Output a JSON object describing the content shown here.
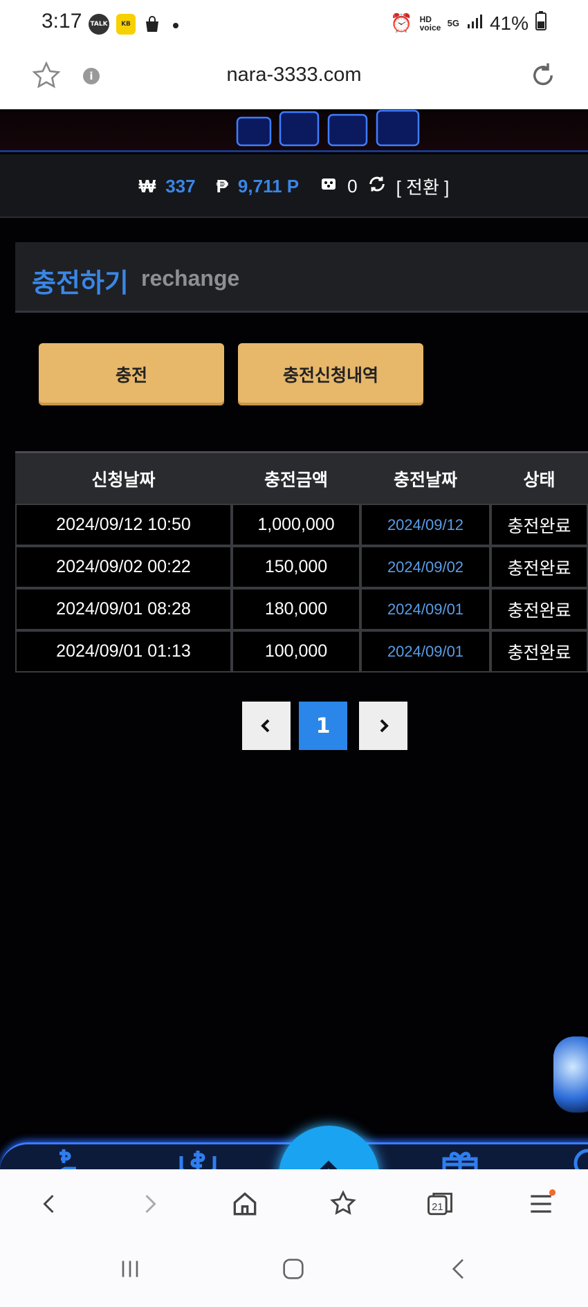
{
  "status_bar": {
    "time": "3:17",
    "battery": "41%",
    "signal_label": "5G",
    "hd_label": "HD voice"
  },
  "url_bar": {
    "url": "nara-3333.com"
  },
  "site": {
    "balance": {
      "won_symbol": "₩",
      "won_value": "337",
      "point_symbol": "₱",
      "point_value": "9,711 P",
      "chip_value": "0",
      "convert_label": "[ 전환 ]"
    },
    "section": {
      "title": "충전하기",
      "subtitle": "rechange"
    },
    "buttons": {
      "charge": "충전",
      "history": "충전신청내역"
    },
    "table": {
      "headers": [
        "신청날짜",
        "충전금액",
        "충전날짜",
        "상태"
      ],
      "rows": [
        [
          "2024/09/12 10:50",
          "1,000,000",
          "2024/09/12",
          "충전완료"
        ],
        [
          "2024/09/02 00:22",
          "150,000",
          "2024/09/02",
          "충전완료"
        ],
        [
          "2024/09/01 08:28",
          "180,000",
          "2024/09/01",
          "충전완료"
        ],
        [
          "2024/09/01 01:13",
          "100,000",
          "2024/09/01",
          "충전완료"
        ]
      ]
    },
    "pagination": {
      "prev": "‹",
      "current": "1",
      "next": "›"
    }
  },
  "browser": {
    "tabs_count": "21"
  }
}
